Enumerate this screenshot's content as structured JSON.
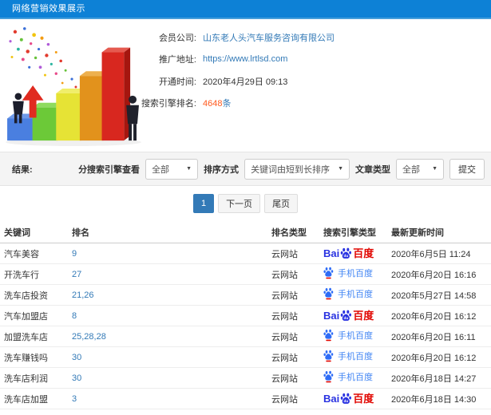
{
  "header": {
    "title": "网络营销效果展示"
  },
  "info": {
    "member_label": "会员公司:",
    "member_value": "山东老人头汽车服务咨询有限公司",
    "url_label": "推广地址:",
    "url_value": "https://www.lrtlsd.com",
    "open_label": "开通时间:",
    "open_value": "2020年4月29日 09:13",
    "rank_label": "搜索引擎排名:",
    "rank_value": "4648",
    "rank_unit": "条"
  },
  "filters": {
    "result_label": "结果:",
    "engine_label": "分搜索引擎查看",
    "engine_value": "全部",
    "sort_label": "排序方式",
    "sort_value": "关键词由短到长排序",
    "article_label": "文章类型",
    "article_value": "全部",
    "submit_label": "提交"
  },
  "pagination": {
    "page_1": "1",
    "next": "下一页",
    "last": "尾页"
  },
  "table": {
    "headers": [
      "关键词",
      "排名",
      "排名类型",
      "搜索引擎类型",
      "最新更新时间"
    ],
    "rows": [
      {
        "keyword": "汽车美容",
        "rank": "9",
        "rank_type": "云网站",
        "engine": "baidu_pc",
        "time": "2020年6月5日 11:24"
      },
      {
        "keyword": "开洗车行",
        "rank": "27",
        "rank_type": "云网站",
        "engine": "baidu_mobile",
        "time": "2020年6月20日 16:16"
      },
      {
        "keyword": "洗车店投资",
        "rank": "21,26",
        "rank_type": "云网站",
        "engine": "baidu_mobile",
        "time": "2020年5月27日 14:58"
      },
      {
        "keyword": "汽车加盟店",
        "rank": "8",
        "rank_type": "云网站",
        "engine": "baidu_pc",
        "time": "2020年6月20日 16:12"
      },
      {
        "keyword": "加盟洗车店",
        "rank": "25,28,28",
        "rank_type": "云网站",
        "engine": "baidu_mobile",
        "time": "2020年6月20日 16:11"
      },
      {
        "keyword": "洗车赚钱吗",
        "rank": "30",
        "rank_type": "云网站",
        "engine": "baidu_mobile",
        "time": "2020年6月20日 16:12"
      },
      {
        "keyword": "洗车店利润",
        "rank": "30",
        "rank_type": "云网站",
        "engine": "baidu_mobile",
        "time": "2020年6月18日 14:27"
      },
      {
        "keyword": "洗车店加盟",
        "rank": "3",
        "rank_type": "云网站",
        "engine": "baidu_pc",
        "time": "2020年6月18日 14:30"
      }
    ]
  },
  "engines": {
    "baidu_pc": {
      "text_left": "Bai",
      "paw_text": "du",
      "text_right": "百度"
    },
    "baidu_mobile": {
      "label": "手机百度"
    }
  },
  "colors": {
    "header_blue": "#0d81d6",
    "link_blue": "#337ab7",
    "rank_count_orange": "#ff5a1e",
    "baidu_blue": "#2932e1",
    "baidu_red": "#e10601",
    "mobile_text_blue": "#4285f4",
    "pagination_active_blue": "#337ab7"
  }
}
